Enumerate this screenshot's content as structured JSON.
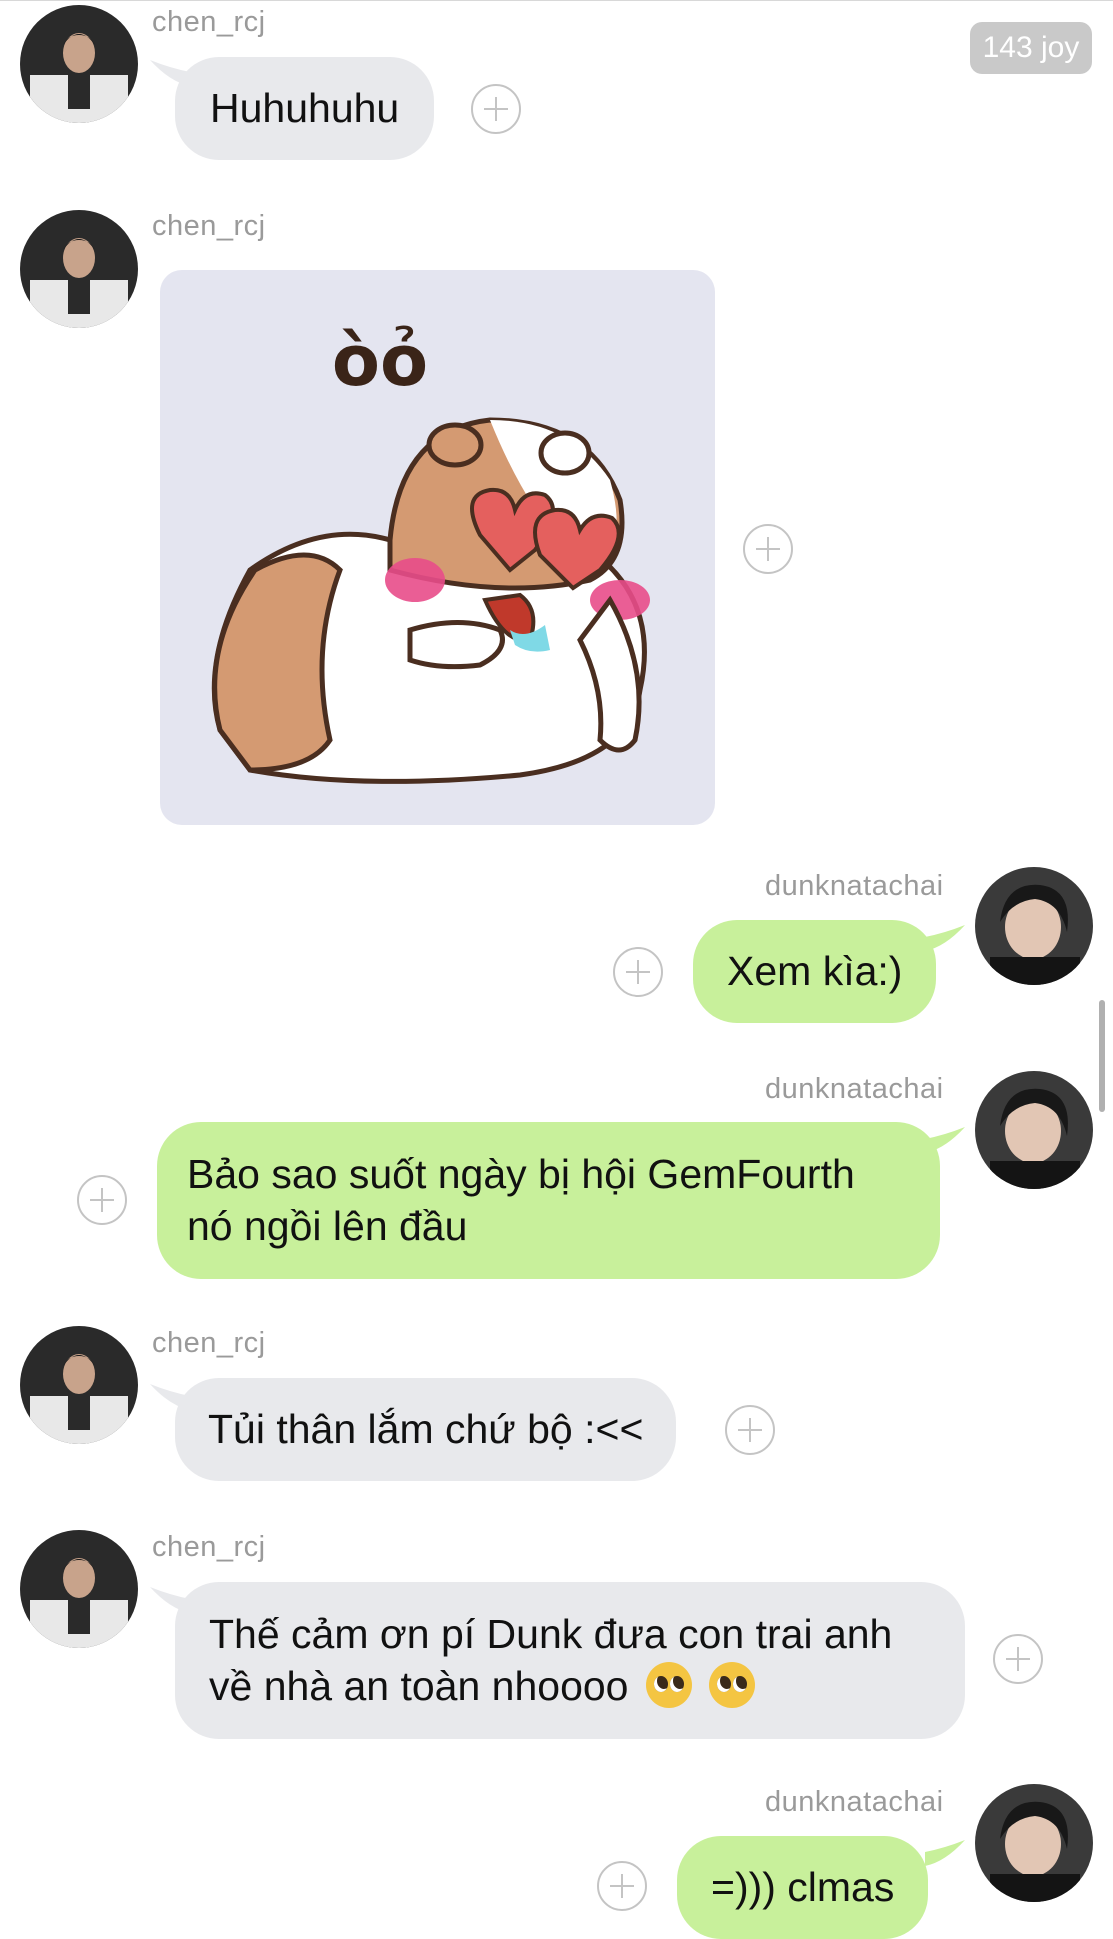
{
  "status": {
    "badge_text": "143 joy"
  },
  "participants": {
    "incoming": "chen_rcj",
    "outgoing": "dunknatachai"
  },
  "messages": [
    {
      "sender": "chen_rcj",
      "type": "text",
      "text": "Huhuhuhu"
    },
    {
      "sender": "chen_rcj",
      "type": "sticker",
      "sticker": "hamster-heart-eyes-sticker",
      "sticker_text": "òỏ"
    },
    {
      "sender": "dunknatachai",
      "type": "text",
      "text": "Xem kìa:)"
    },
    {
      "sender": "dunknatachai",
      "type": "text",
      "lines": [
        "Bảo sao suốt ngày bị hội GemFourth",
        "nó ngồi lên đầu"
      ]
    },
    {
      "sender": "chen_rcj",
      "type": "text",
      "text": "Tủi thân lắm chứ bộ :<<"
    },
    {
      "sender": "chen_rcj",
      "type": "text",
      "lines": [
        "Thế cảm ơn pí Dunk đưa con trai anh",
        "về nhà an toàn nhoooo"
      ],
      "trailing_emoji": "pleading-face-emoji x2"
    },
    {
      "sender": "dunknatachai",
      "type": "text",
      "text": "=))) clmas"
    }
  ],
  "colors": {
    "incoming_bubble": "#e8e9ec",
    "outgoing_bubble": "#c8f09b",
    "sender_name": "#9a9a9a",
    "badge_bg": "#c9c9c9"
  }
}
